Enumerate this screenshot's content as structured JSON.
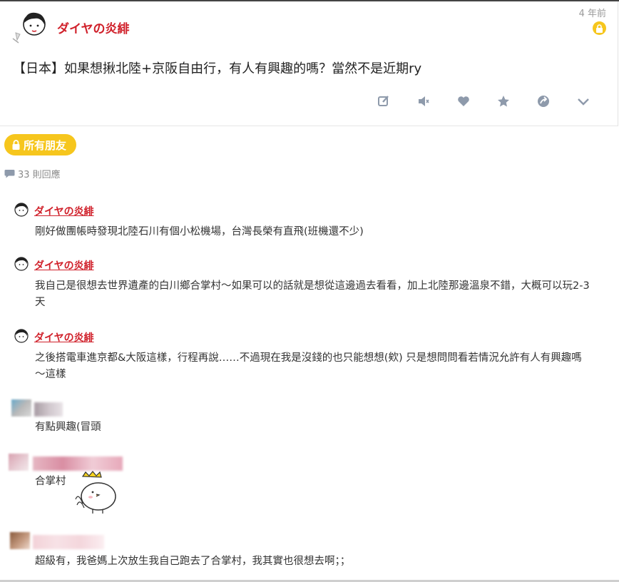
{
  "post": {
    "author": "ダイヤの炎緋",
    "time": "4 年前",
    "title": "【日本】如果想揪北陸+京阪自由行，有人有興趣的嗎？當然不是近期ry",
    "actions": [
      "edit-icon",
      "mute-icon",
      "heart-icon",
      "star-icon",
      "share-icon",
      "chevron-down-icon"
    ]
  },
  "audience": {
    "label": "所有朋友"
  },
  "replies": {
    "count_label": "33 則回應"
  },
  "comments": [
    {
      "author": "ダイヤの炎緋",
      "text": "剛好做團帳時發現北陸石川有個小松機場，台灣長榮有直飛(班機還不少)"
    },
    {
      "author": "ダイヤの炎緋",
      "text": "我自己是很想去世界遺產的白川鄉合掌村～如果可以的話就是想從這邊過去看看，加上北陸那邊溫泉不錯，大概可以玩2-3天"
    },
    {
      "author": "ダイヤの炎緋",
      "text": "之後搭電車進京都&大阪這樣，行程再說……不過現在我是沒錢的也只能想想(欸) 只是想問問看若情況允許有人有興趣嗎～這樣"
    },
    {
      "author": "",
      "text": "有點興趣(冒頭"
    },
    {
      "author": "",
      "text": "合掌村"
    },
    {
      "author": "",
      "text": "超級有，我爸媽上次放生我自己跑去了合掌村，我其實也很想去啊；；"
    }
  ],
  "colors": {
    "accent": "#d0202a",
    "badge": "#f6c61d",
    "icon": "#8e9aab"
  }
}
